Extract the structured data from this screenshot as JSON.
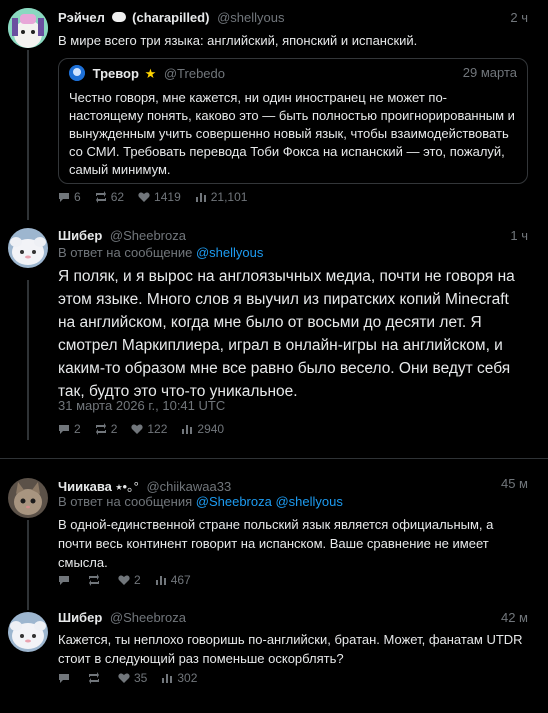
{
  "posts": [
    {
      "name": "Рэйчел",
      "name_suffix": "(charapilled)",
      "handle": "@shellyous",
      "time": "2 ч",
      "text": "В мире всего три языка: английский, японский и испанский.",
      "quote": {
        "name": "Тревор",
        "handle": "@Trebedo",
        "time": "29 марта",
        "text": "Честно говоря, мне кажется, ни один иностранец не может по-настоящему понять, каково это — быть полностью проигнорированным и вынужденным учить совершенно новый язык, чтобы взаимодействовать со СМИ. Требовать перевода Тоби Фокса на испанский — это, пожалуй, самый минимум."
      },
      "stats": {
        "replies": "6",
        "reposts": "62",
        "likes": "1419",
        "views": "21,101"
      }
    },
    {
      "name": "Шибер",
      "handle": "@Sheebroza",
      "time": "1 ч",
      "reply_prefix": "В ответ на сообщение",
      "reply_to": "@shellyous",
      "text": "Я поляк, и я вырос на англоязычных медиа, почти не говоря на этом языке. Много слов я выучил из пиратских копий Minecraft на английском, когда мне было от восьми до десяти лет. Я смотрел Маркиплиера, играл в онлайн-игры на английском, и каким-то образом мне все равно было весело. Они ведут себя так, будто это что-то уникальное.",
      "date": "31 марта 2026 г., 10:41 UTC",
      "stats": {
        "replies": "2",
        "reposts": "2",
        "likes": "122",
        "views": "2940"
      }
    },
    {
      "name": "Чиикава",
      "name_deco": "⭑•｡°",
      "handle": "@chiikawaa33",
      "time": "45 м",
      "reply_prefix": "В ответ на сообщения",
      "reply_to": "@Sheebroza @shellyous",
      "text": "В одной-единственной стране польский язык является официальным, а почти весь континент говорит на испанском. Ваше сравнение не имеет смысла.",
      "stats": {
        "replies": "",
        "reposts": "",
        "likes": "2",
        "views": "467"
      }
    },
    {
      "name": "Шибер",
      "handle": "@Sheebroza",
      "time": "42 м",
      "text": "Кажется, ты неплохо говоришь по-английски, братан. Может, фанатам UTDR стоит в следующий раз поменьше оскорблять?",
      "stats": {
        "replies": "",
        "reposts": "",
        "likes": "35",
        "views": "302"
      }
    }
  ],
  "icons": {
    "reply": "comment-icon",
    "repost": "repost-icon",
    "like": "heart-icon",
    "views": "bar-chart-icon",
    "name_badge": "sheep-emoji-icon",
    "verified": "star-icon"
  },
  "colors": {
    "background": "#000000",
    "text": "#e7e9ea",
    "muted": "#71767b",
    "link": "#1d9bf0",
    "star": "#ffd400"
  }
}
